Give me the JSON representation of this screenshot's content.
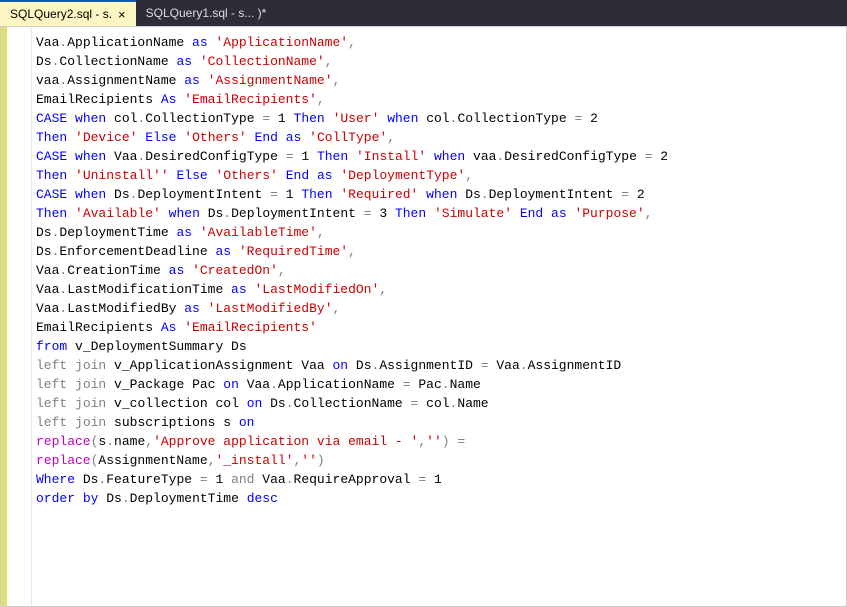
{
  "tabs": [
    {
      "label": "SQLQuery2.sql - s.",
      "close": "×"
    },
    {
      "label": "SQLQuery1.sql - s...                           )*"
    }
  ],
  "code": {
    "l1": {
      "a": "Vaa",
      "b": "ApplicationName ",
      "as": "as",
      "s": "'ApplicationName'",
      "c": ","
    },
    "l2": {
      "a": "Ds",
      "b": "CollectionName ",
      "as": "as",
      "s": "'CollectionName'",
      "c": ","
    },
    "l3": {
      "a": "vaa",
      "b": "AssignmentName ",
      "as": "as",
      "s": "'AssignmentName'",
      "c": ","
    },
    "l4": {
      "a": "EmailRecipients ",
      "as": "As",
      "s": "'EmailRecipients'",
      "c": ","
    },
    "l5": {
      "case": "CASE",
      "when": "when",
      "a": " col",
      "b": "CollectionType ",
      "eq": "=",
      "n": " 1 ",
      "then": "Then",
      "s": "'User'",
      "when2": "when",
      "a2": " col",
      "b2": "CollectionType ",
      "eq2": "=",
      "n2": " 2"
    },
    "l6": {
      "then": "Then",
      "s1": "'Device'",
      "else": "Else",
      "s2": "'Others'",
      "end": "End",
      "as": "as",
      "s3": "'CollType'",
      "c": ","
    },
    "l7": {
      "case": "CASE",
      "when": "when",
      "a": " Vaa",
      "b": "DesiredConfigType ",
      "eq": "=",
      "n": " 1 ",
      "then": "Then",
      "s": "'Install'",
      "when2": "when",
      "a2": " vaa",
      "b2": "DesiredConfigType ",
      "eq2": "=",
      "n2": " 2"
    },
    "l8": {
      "then": "Then",
      "s1": "'Uninstall''",
      "else": "Else",
      "s2": "'Others'",
      "end": "End",
      "as": "as",
      "s3": "'DeploymentType'",
      "c": ","
    },
    "l9": {
      "case": "CASE",
      "when": "when",
      "a": " Ds",
      "b": "DeploymentIntent ",
      "eq": "=",
      "n": " 1 ",
      "then": "Then",
      "s": "'Required'",
      "when2": "when",
      "a2": " Ds",
      "b2": "DeploymentIntent ",
      "eq2": "=",
      "n2": " 2"
    },
    "l10": {
      "then": "Then",
      "s1": "'Available'",
      "when": "when",
      "a": " Ds",
      "b": "DeploymentIntent ",
      "eq": "=",
      "n": " 3 ",
      "then2": "Then",
      "s2": "'Simulate'",
      "end": "End",
      "as": "as",
      "s3": "'Purpose'",
      "c": ","
    },
    "l11": {
      "a": "Ds",
      "b": "DeploymentTime ",
      "as": "as",
      "s": "'AvailableTime'",
      "c": ","
    },
    "l12": {
      "a": "Ds",
      "b": "EnforcementDeadline ",
      "as": "as",
      "s": "'RequiredTime'",
      "c": ","
    },
    "l13": {
      "a": "Vaa",
      "b": "CreationTime ",
      "as": "as",
      "s": "'CreatedOn'",
      "c": ","
    },
    "l14": {
      "a": "Vaa",
      "b": "LastModificationTime ",
      "as": "as",
      "s": "'LastModifiedOn'",
      "c": ","
    },
    "l15": {
      "a": "Vaa",
      "b": "LastModifiedBy ",
      "as": "as",
      "s": "'LastModifiedBy'",
      "c": ","
    },
    "l16": {
      "a": "EmailRecipients ",
      "as": "As",
      "s": "'EmailRecipients'"
    },
    "l17": {
      "from": "from",
      "t": " v_DeploymentSummary Ds"
    },
    "l18": {
      "lj": "left",
      "j": "join",
      "t": " v_ApplicationAssignment Vaa ",
      "on": "on",
      "a1": " Ds",
      "b1": "AssignmentID ",
      "eq": "=",
      "a2": " Vaa",
      "b2": "AssignmentID"
    },
    "l19": {
      "lj": "left",
      "j": "join",
      "t": " v_Package Pac ",
      "on": "on",
      "a1": " Vaa",
      "b1": "ApplicationName ",
      "eq": "=",
      "a2": " Pac",
      "b2": "Name"
    },
    "l20": {
      "lj": "left",
      "j": "join",
      "t": " v_collection col ",
      "on": "on",
      "a1": " Ds",
      "b1": "CollectionName ",
      "eq": "=",
      "a2": " col",
      "b2": "Name"
    },
    "l21": {
      "lj": "left",
      "j": "join",
      "t": " subscriptions s ",
      "on": "on"
    },
    "l22": {
      "fn": "replace",
      "p1": "(",
      "a": "s",
      "b": "name",
      "c1": ",",
      "s1": "'Approve application via email - '",
      "c2": ",",
      "s2": "''",
      "p2": ")",
      "eq": " ="
    },
    "l23": {
      "fn": "replace",
      "p1": "(",
      "a": "AssignmentName",
      "c1": ",",
      "s1": "'_install'",
      "c2": ",",
      "s2": "''",
      "p2": ")"
    },
    "l24": {
      "where": "Where",
      "a1": " Ds",
      "b1": "FeatureType ",
      "eq1": "=",
      "n1": " 1 ",
      "and": "and",
      "a2": " Vaa",
      "b2": "RequireApproval ",
      "eq2": "=",
      "n2": " 1"
    },
    "l25": {
      "order": "order",
      "by": "by",
      "a": " Ds",
      "b": "DeploymentTime ",
      "desc": "desc"
    }
  }
}
